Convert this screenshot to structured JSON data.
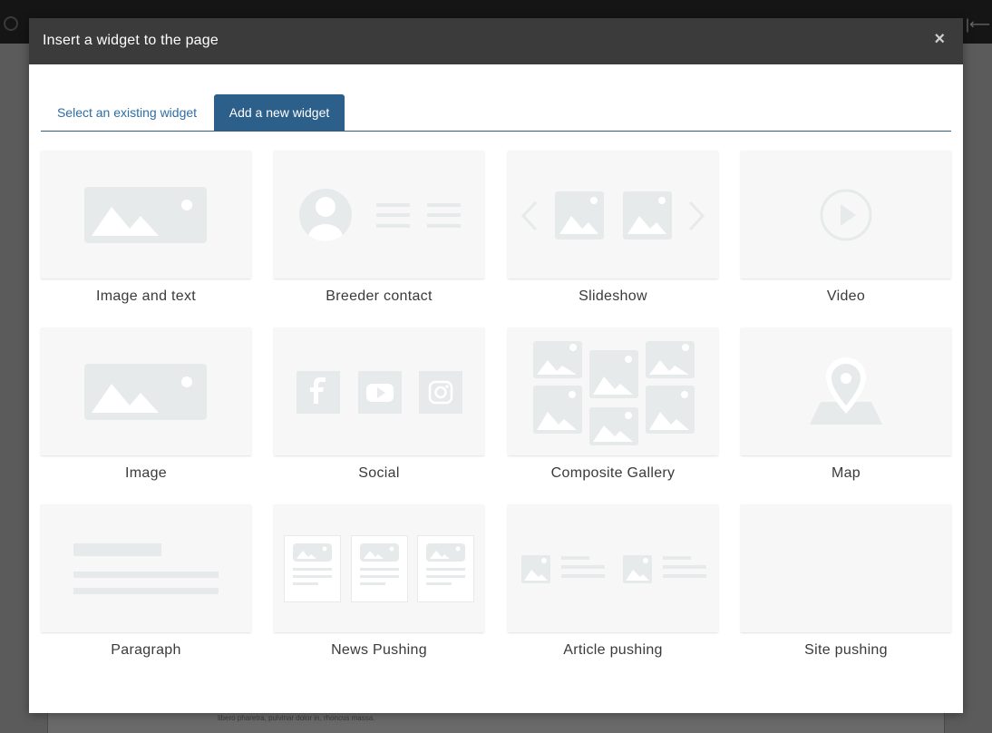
{
  "modal": {
    "title": "Insert a widget to the page",
    "close_label": "×"
  },
  "tabs": [
    {
      "label": "Select an existing widget",
      "active": false
    },
    {
      "label": "Add a new widget",
      "active": true
    }
  ],
  "widgets": [
    {
      "label": "Image and text",
      "icon": "image-and-text-icon"
    },
    {
      "label": "Breeder contact",
      "icon": "breeder-contact-icon"
    },
    {
      "label": "Slideshow",
      "icon": "slideshow-icon"
    },
    {
      "label": "Video",
      "icon": "video-play-icon"
    },
    {
      "label": "Image",
      "icon": "image-icon"
    },
    {
      "label": "Social",
      "icon": "social-icons"
    },
    {
      "label": "Composite Gallery",
      "icon": "composite-gallery-icon"
    },
    {
      "label": "Map",
      "icon": "map-pin-icon"
    },
    {
      "label": "Paragraph",
      "icon": "paragraph-icon"
    },
    {
      "label": "News Pushing",
      "icon": "news-pushing-icon"
    },
    {
      "label": "Article pushing",
      "icon": "article-pushing-icon"
    },
    {
      "label": "Site pushing",
      "icon": ""
    }
  ],
  "background": {
    "text": "libero pharetra, pulvinar dolor in, rhoncus massa."
  },
  "colors": {
    "accent": "#2c5f8a",
    "header": "#3b3b3b",
    "placeholder": "#e6eaea"
  }
}
